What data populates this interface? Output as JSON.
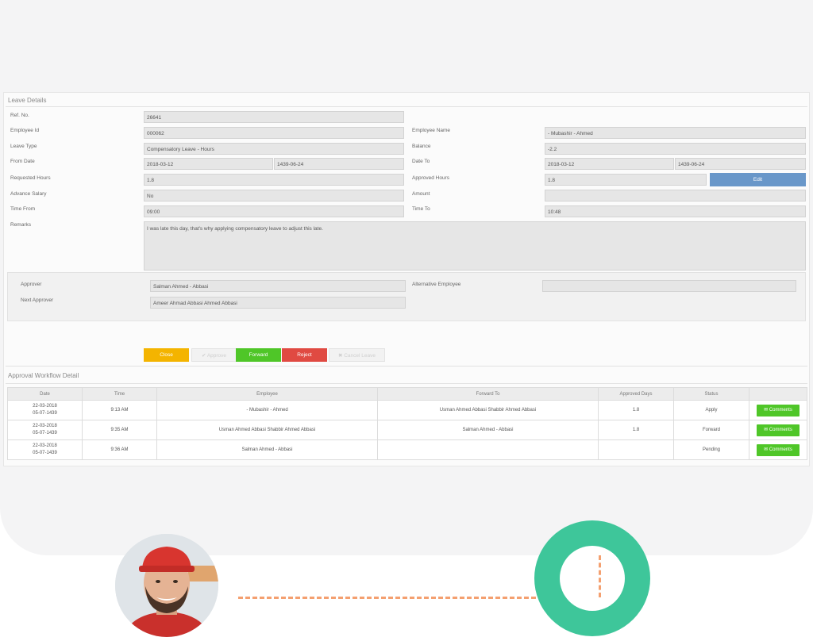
{
  "leave_details": {
    "title": "Leave Details",
    "ref_no": {
      "label": "Ref. No.",
      "value": "26641"
    },
    "employee_id": {
      "label": "Employee Id",
      "value": "000062"
    },
    "employee_name": {
      "label": "Employee Name",
      "value": "- Mubashir - Ahmed"
    },
    "leave_type": {
      "label": "Leave Type",
      "value": "Compensatory Leave - Hours"
    },
    "balance": {
      "label": "Balance",
      "value": "-2.2"
    },
    "from_date": {
      "label": "From Date",
      "value": "2018-03-12",
      "hijri": "1439-06-24"
    },
    "date_to": {
      "label": "Date To",
      "value": "2018-03-12",
      "hijri": "1439-06-24"
    },
    "requested_hours": {
      "label": "Requested Hours",
      "value": "1.8"
    },
    "approved_hours": {
      "label": "Approved Hours",
      "value": "1.8"
    },
    "edit_label": "Edit",
    "advance_salary": {
      "label": "Advance Salary",
      "value": "No"
    },
    "amount": {
      "label": "Amount",
      "value": ""
    },
    "time_from": {
      "label": "Time From",
      "value": "09:00"
    },
    "time_to": {
      "label": "Time To",
      "value": "10:48"
    },
    "remarks": {
      "label": "Remarks",
      "value": "I was late this day, that's why applying compensatory leave to adjust this late."
    }
  },
  "approvers": {
    "approver": {
      "label": "Approver",
      "value": "Salman Ahmed - Abbasi"
    },
    "next_approver": {
      "label": "Next Approver",
      "value": "Ameer Ahmad Abbasi Ahmed Abbasi"
    },
    "alternative_employee": {
      "label": "Alternative Employee",
      "value": ""
    }
  },
  "actions": {
    "close": "Close",
    "approve": "✔ Approve",
    "forward": "Forward",
    "reject": "Reject",
    "cancel_leave": "✖ Cancel Leave"
  },
  "workflow": {
    "title": "Approval Workflow Detail",
    "headers": [
      "Date",
      "Time",
      "Employee",
      "Forward To",
      "Approved Days",
      "Status",
      ""
    ],
    "comments_label": "Comments",
    "rows": [
      {
        "date": "22-03-2018",
        "hijri": "05-07-1439",
        "time": "9:13 AM",
        "employee": "- Mubashir - Ahmed",
        "forward_to": "Usman Ahmed Abbasi Shabbir Ahmed Abbasi",
        "days": "1.8",
        "status": "Apply"
      },
      {
        "date": "22-03-2018",
        "hijri": "05-07-1439",
        "time": "9:35 AM",
        "employee": "Usman Ahmed Abbasi Shabbir Ahmed Abbasi",
        "forward_to": "Salman Ahmed - Abbasi",
        "days": "1.8",
        "status": "Forward"
      },
      {
        "date": "22-03-2018",
        "hijri": "05-07-1439",
        "time": "9:36 AM",
        "employee": "Salman Ahmed - Abbasi",
        "forward_to": "",
        "days": "",
        "status": "Pending"
      }
    ]
  },
  "colors": {
    "close": "#f4b400",
    "forward": "#4fc628",
    "reject": "#e04a42",
    "edit": "#6997c9",
    "comments": "#4fc628",
    "ring": "#3ec69a",
    "dash": "#f4a070"
  }
}
